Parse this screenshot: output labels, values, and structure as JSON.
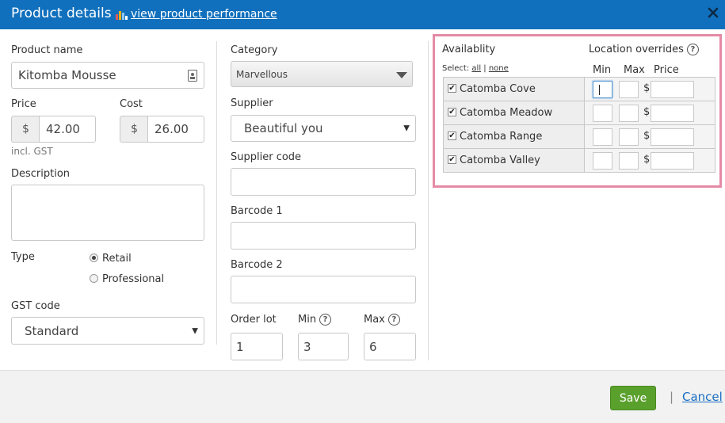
{
  "header": {
    "title": "Product details",
    "performance_link": "view product performance"
  },
  "product_name": {
    "label": "Product name",
    "value": "Kitomba Mousse"
  },
  "price": {
    "label": "Price",
    "prefix": "$",
    "value": "42.00",
    "note": "incl. GST"
  },
  "cost": {
    "label": "Cost",
    "prefix": "$",
    "value": "26.00"
  },
  "description": {
    "label": "Description",
    "value": ""
  },
  "type": {
    "label": "Type",
    "options": [
      {
        "label": "Retail",
        "selected": true
      },
      {
        "label": "Professional",
        "selected": false
      }
    ]
  },
  "gst": {
    "label": "GST code",
    "value": "Standard"
  },
  "category": {
    "label": "Category",
    "value": "Marvellous"
  },
  "supplier": {
    "label": "Supplier",
    "value": "Beautiful you"
  },
  "supplier_code": {
    "label": "Supplier code",
    "value": ""
  },
  "barcode1": {
    "label": "Barcode 1",
    "value": ""
  },
  "barcode2": {
    "label": "Barcode 2",
    "value": ""
  },
  "order_lot": {
    "label": "Order lot",
    "value": "1"
  },
  "min": {
    "label": "Min",
    "value": "3"
  },
  "max": {
    "label": "Max",
    "value": "6"
  },
  "help_glyph": "?",
  "availability": {
    "label": "Availablity",
    "select_label": "Select:",
    "select_all": "all",
    "select_sep": "|",
    "select_none": "none",
    "overrides_label": "Location overrides",
    "col_min": "Min",
    "col_max": "Max",
    "col_price": "Price",
    "currency": "$",
    "locations": [
      {
        "name": "Catomba Cove",
        "checked": true
      },
      {
        "name": "Catomba Meadow",
        "checked": true
      },
      {
        "name": "Catomba Range",
        "checked": true
      },
      {
        "name": "Catomba Valley",
        "checked": true
      }
    ]
  },
  "footer": {
    "save": "Save",
    "separator": "|",
    "cancel": "Cancel"
  },
  "colors": {
    "header": "#1070bd",
    "save": "#5aa02c",
    "highlight": "#e58aa6",
    "link": "#1a6ec0"
  },
  "icons": {
    "chart": "bar-chart-icon",
    "close": "close-icon",
    "contact": "contact-card-icon",
    "help": "help-icon"
  }
}
